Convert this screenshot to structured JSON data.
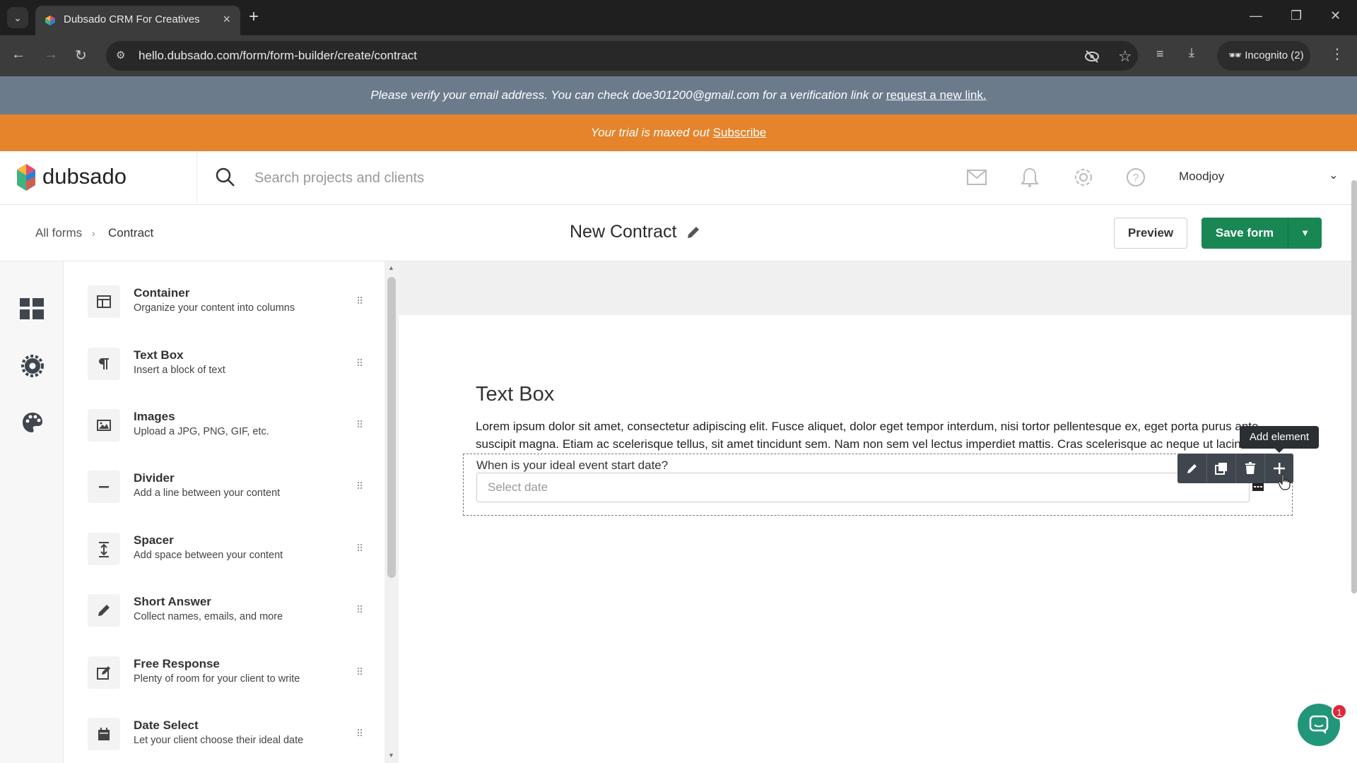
{
  "browser": {
    "tab_title": "Dubsado CRM For Creatives",
    "url": "hello.dubsado.com/form/form-builder/create/contract",
    "incognito_label": "Incognito (2)"
  },
  "banners": {
    "verify_text": "Please verify your email address. You can check doe301200@gmail.com for a verification link or ",
    "verify_link": "request a new link.",
    "trial_text": "Your trial is maxed out ",
    "trial_link": "Subscribe"
  },
  "header": {
    "logo_text": "dubsado",
    "search_placeholder": "Search projects and clients",
    "user_name": "Moodjoy"
  },
  "subheader": {
    "breadcrumb_root": "All forms",
    "breadcrumb_current": "Contract",
    "form_title": "New Contract",
    "preview_label": "Preview",
    "save_label": "Save form"
  },
  "elements": [
    {
      "name": "Container",
      "desc": "Organize your content into columns",
      "icon": "columns-icon"
    },
    {
      "name": "Text Box",
      "desc": "Insert a block of text",
      "icon": "paragraph-icon"
    },
    {
      "name": "Images",
      "desc": "Upload a JPG, PNG, GIF, etc.",
      "icon": "image-icon"
    },
    {
      "name": "Divider",
      "desc": "Add a line between your content",
      "icon": "minus-icon"
    },
    {
      "name": "Spacer",
      "desc": "Add space between your content",
      "icon": "spacer-icon"
    },
    {
      "name": "Short Answer",
      "desc": "Collect names, emails, and more",
      "icon": "pencil-icon"
    },
    {
      "name": "Free Response",
      "desc": "Plenty of room for your client to write",
      "icon": "edit-box-icon"
    },
    {
      "name": "Date Select",
      "desc": "Let your client choose their ideal date",
      "icon": "calendar-icon"
    }
  ],
  "canvas": {
    "textbox_heading": "Text Box",
    "textbox_body": "Lorem ipsum dolor sit amet, consectetur adipiscing elit. Fusce aliquet, dolor eget tempor interdum, nisi tortor pellentesque ex, eget porta purus ante suscipit magna. Etiam ac scelerisque tellus, sit amet tincidunt sem. Nam non sem vel lectus imperdiet mattis. Cras scelerisque ac neque ut lacinia.",
    "date_question": "When is your ideal event start date?",
    "date_placeholder": "Select date",
    "tooltip": "Add element"
  },
  "chat_badge_count": "1",
  "colors": {
    "primary_green": "#198754",
    "trial_orange": "#e6842b",
    "verify_gray": "#6b7b8c",
    "chat_teal": "#22967a"
  }
}
